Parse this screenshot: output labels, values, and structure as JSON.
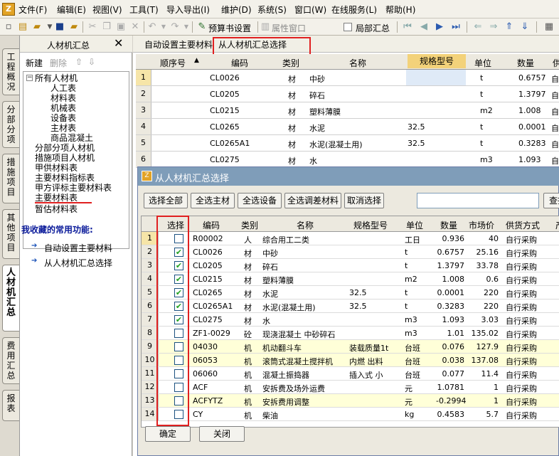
{
  "menu": [
    "文件(F)",
    "编辑(E)",
    "视图(V)",
    "工具(T)",
    "导入导出(I)",
    "维护(D)",
    "系统(S)",
    "窗口(W)",
    "在线服务(L)",
    "帮助(H)"
  ],
  "toolbar": {
    "budget_settings": "预算书设置",
    "property_window": "属性窗口",
    "local_summary": "局部汇总"
  },
  "vtabs": [
    "工程概况",
    "分部分项",
    "措施项目",
    "其他项目",
    "人材机汇总",
    "费用汇总",
    "报表"
  ],
  "left_panel": {
    "title": "人材机汇总",
    "new": "新建",
    "delete": "删除",
    "tree": {
      "root": "所有人材机",
      "children": [
        "人工表",
        "材料表",
        "机械表",
        "设备表",
        "主材表",
        "商品混凝土"
      ],
      "others": [
        "分部分项人材机",
        "措施项目人材机",
        "甲供材料表",
        "主要材料指标表",
        "甲方评标主要材料表",
        "主要材料表",
        "暂估材料表"
      ]
    },
    "favorites_title": "我收藏的常用功能:",
    "favorites": [
      "自动设置主要材料",
      "从人材机汇总选择"
    ]
  },
  "main": {
    "tabs": [
      "自动设置主要材料",
      "从人材机汇总选择"
    ],
    "columns": [
      "顺序号",
      "编码",
      "类别",
      "名称",
      "规格型号",
      "单位",
      "数量",
      "供"
    ],
    "rows": [
      {
        "n": "1",
        "code": "CL0026",
        "type": "材",
        "name": "中砂",
        "spec": "",
        "unit": "t",
        "qty": "0.6757",
        "supply": "自"
      },
      {
        "n": "2",
        "code": "CL0205",
        "type": "材",
        "name": "碎石",
        "spec": "",
        "unit": "t",
        "qty": "1.3797",
        "supply": "自"
      },
      {
        "n": "3",
        "code": "CL0215",
        "type": "材",
        "name": "塑料薄膜",
        "spec": "",
        "unit": "m2",
        "qty": "1.008",
        "supply": "自"
      },
      {
        "n": "4",
        "code": "CL0265",
        "type": "材",
        "name": "水泥",
        "spec": "32.5",
        "unit": "t",
        "qty": "0.0001",
        "supply": "自"
      },
      {
        "n": "5",
        "code": "CL0265A1",
        "type": "材",
        "name": "水泥(混凝土用)",
        "spec": "32.5",
        "unit": "t",
        "qty": "0.3283",
        "supply": "自"
      },
      {
        "n": "6",
        "code": "CL0275",
        "type": "材",
        "name": "水",
        "spec": "",
        "unit": "m3",
        "qty": "1.093",
        "supply": "自"
      }
    ]
  },
  "dialog": {
    "title": "从人材机汇总选择",
    "buttons": [
      "选择全部",
      "全选主材",
      "全选设备",
      "全选调差材料",
      "取消选择"
    ],
    "search_button": "查找",
    "columns": [
      "选择",
      "编码",
      "类别",
      "名称",
      "规格型号",
      "单位",
      "数量",
      "市场价",
      "供货方式",
      "产"
    ],
    "rows": [
      {
        "n": "1",
        "checked": false,
        "code": "R00002",
        "type": "人",
        "name": "综合用工二类",
        "spec": "",
        "unit": "工日",
        "qty": "0.936",
        "price": "40",
        "supply": "自行采购",
        "hl": false
      },
      {
        "n": "2",
        "checked": true,
        "code": "CL0026",
        "type": "材",
        "name": "中砂",
        "spec": "",
        "unit": "t",
        "qty": "0.6757",
        "price": "25.16",
        "supply": "自行采购",
        "hl": false
      },
      {
        "n": "3",
        "checked": true,
        "code": "CL0205",
        "type": "材",
        "name": "碎石",
        "spec": "",
        "unit": "t",
        "qty": "1.3797",
        "price": "33.78",
        "supply": "自行采购",
        "hl": false
      },
      {
        "n": "4",
        "checked": true,
        "code": "CL0215",
        "type": "材",
        "name": "塑料薄膜",
        "spec": "",
        "unit": "m2",
        "qty": "1.008",
        "price": "0.6",
        "supply": "自行采购",
        "hl": false
      },
      {
        "n": "5",
        "checked": true,
        "code": "CL0265",
        "type": "材",
        "name": "水泥",
        "spec": "32.5",
        "unit": "t",
        "qty": "0.0001",
        "price": "220",
        "supply": "自行采购",
        "hl": false
      },
      {
        "n": "6",
        "checked": true,
        "code": "CL0265A1",
        "type": "材",
        "name": "水泥(混凝土用)",
        "spec": "32.5",
        "unit": "t",
        "qty": "0.3283",
        "price": "220",
        "supply": "自行采购",
        "hl": false
      },
      {
        "n": "7",
        "checked": true,
        "code": "CL0275",
        "type": "材",
        "name": "水",
        "spec": "",
        "unit": "m3",
        "qty": "1.093",
        "price": "3.03",
        "supply": "自行采购",
        "hl": false
      },
      {
        "n": "8",
        "checked": false,
        "code": "ZF1-0029",
        "type": "砼",
        "name": "现浇混凝土 中砂碎石",
        "spec": "",
        "unit": "m3",
        "qty": "1.01",
        "price": "135.02",
        "supply": "自行采购",
        "hl": false
      },
      {
        "n": "9",
        "checked": false,
        "code": "04030",
        "type": "机",
        "name": "机动翻斗车",
        "spec": "装载质量1t",
        "unit": "台班",
        "qty": "0.076",
        "price": "127.9",
        "supply": "自行采购",
        "hl": true
      },
      {
        "n": "10",
        "checked": false,
        "code": "06053",
        "type": "机",
        "name": "滚筒式混凝土搅拌机",
        "spec": "内燃 出料",
        "unit": "台班",
        "qty": "0.038",
        "price": "137.08",
        "supply": "自行采购",
        "hl": true
      },
      {
        "n": "11",
        "checked": false,
        "code": "06060",
        "type": "机",
        "name": "混凝土振捣器",
        "spec": "插入式 小",
        "unit": "台班",
        "qty": "0.077",
        "price": "11.4",
        "supply": "自行采购",
        "hl": false
      },
      {
        "n": "12",
        "checked": false,
        "code": "ACF",
        "type": "机",
        "name": "安拆费及场外运费",
        "spec": "",
        "unit": "元",
        "qty": "1.0781",
        "price": "1",
        "supply": "自行采购",
        "hl": false
      },
      {
        "n": "13",
        "checked": false,
        "code": "ACFYTZ",
        "type": "机",
        "name": "安拆费用调整",
        "spec": "",
        "unit": "元",
        "qty": "-0.2994",
        "price": "1",
        "supply": "自行采购",
        "hl": true
      },
      {
        "n": "14",
        "checked": false,
        "code": "CY",
        "type": "机",
        "name": "柴油",
        "spec": "",
        "unit": "kg",
        "qty": "0.4583",
        "price": "5.7",
        "supply": "自行采购",
        "hl": false
      }
    ],
    "ok_button": "确定",
    "close_button": "关闭"
  }
}
